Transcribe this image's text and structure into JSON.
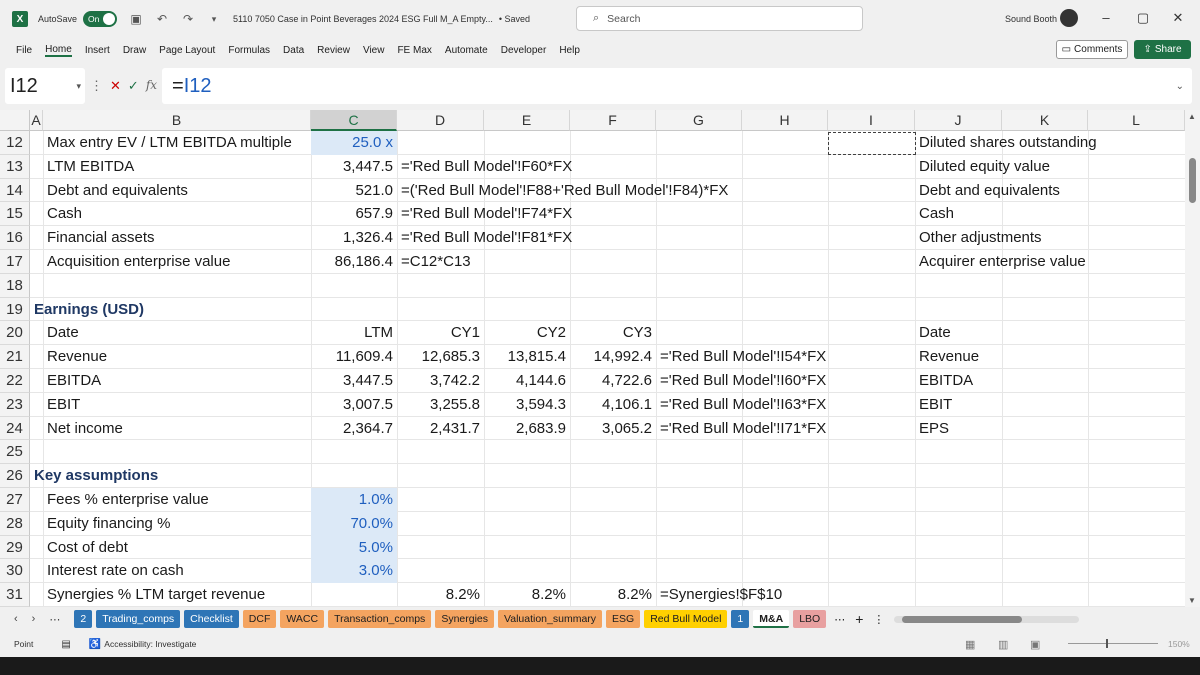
{
  "titlebar": {
    "autosave_label": "AutoSave",
    "autosave_state": "On",
    "file_name": "5110 7050 Case in Point Beverages 2024 ESG Full M_A Empty...",
    "saved_status": "• Saved",
    "search_placeholder": "Search",
    "user_name": "Sound Booth"
  },
  "ribbon": {
    "tabs": [
      "File",
      "Home",
      "Insert",
      "Draw",
      "Page Layout",
      "Formulas",
      "Data",
      "Review",
      "View",
      "FE Max",
      "Automate",
      "Developer",
      "Help"
    ],
    "active_tab": "Home",
    "comments_label": "Comments",
    "share_label": "Share"
  },
  "formula_bar": {
    "name_box": "I12",
    "formula_eq": "=",
    "formula_ref": "I12"
  },
  "columns": [
    "A",
    "B",
    "C",
    "D",
    "E",
    "F",
    "G",
    "H",
    "I",
    "J",
    "K",
    "L"
  ],
  "selected_column": "C",
  "rows": [
    {
      "num": "12",
      "B": "Max entry EV / LTM EBITDA multiple",
      "C": "25.0 x",
      "D": "",
      "E": "",
      "F": "",
      "G": "",
      "J": "Diluted shares outstanding"
    },
    {
      "num": "13",
      "B": "LTM EBITDA",
      "C": "3,447.5",
      "D": "='Red Bull Model'!F60*FX",
      "E": "",
      "F": "",
      "G": "",
      "J": "Diluted equity value"
    },
    {
      "num": "14",
      "B": "Debt and equivalents",
      "C": "521.0",
      "D": "=('Red Bull Model'!F88+'Red Bull Model'!F84)*FX",
      "E": "",
      "F": "",
      "G": "",
      "J": "Debt and equivalents"
    },
    {
      "num": "15",
      "B": "Cash",
      "C": "657.9",
      "D": "='Red Bull Model'!F74*FX",
      "E": "",
      "F": "",
      "G": "",
      "J": "Cash"
    },
    {
      "num": "16",
      "B": "Financial assets",
      "C": "1,326.4",
      "D": "='Red Bull Model'!F81*FX",
      "E": "",
      "F": "",
      "G": "",
      "J": "Other adjustments"
    },
    {
      "num": "17",
      "B": "Acquisition enterprise value",
      "C": "86,186.4",
      "D": "=C12*C13",
      "E": "",
      "F": "",
      "G": "",
      "J": "Acquirer enterprise value"
    },
    {
      "num": "18",
      "B": "",
      "C": "",
      "D": "",
      "E": "",
      "F": "",
      "G": "",
      "J": ""
    },
    {
      "num": "19",
      "A": "Earnings (USD)",
      "B": "",
      "C": "",
      "D": "",
      "E": "",
      "F": "",
      "G": "",
      "J": ""
    },
    {
      "num": "20",
      "B": "Date",
      "C": "LTM",
      "D": "CY1",
      "E": "CY2",
      "F": "CY3",
      "G": "",
      "J": "Date"
    },
    {
      "num": "21",
      "B": "Revenue",
      "C": "11,609.4",
      "D": "12,685.3",
      "E": "13,815.4",
      "F": "14,992.4",
      "G": "='Red Bull Model'!I54*FX",
      "J": "Revenue"
    },
    {
      "num": "22",
      "B": "EBITDA",
      "C": "3,447.5",
      "D": "3,742.2",
      "E": "4,144.6",
      "F": "4,722.6",
      "G": "='Red Bull Model'!I60*FX",
      "J": "EBITDA"
    },
    {
      "num": "23",
      "B": "EBIT",
      "C": "3,007.5",
      "D": "3,255.8",
      "E": "3,594.3",
      "F": "4,106.1",
      "G": "='Red Bull Model'!I63*FX",
      "J": "EBIT"
    },
    {
      "num": "24",
      "B": "Net income",
      "C": "2,364.7",
      "D": "2,431.7",
      "E": "2,683.9",
      "F": "3,065.2",
      "G": "='Red Bull Model'!I71*FX",
      "J": "EPS"
    },
    {
      "num": "25",
      "B": "",
      "C": "",
      "D": "",
      "E": "",
      "F": "",
      "G": "",
      "J": ""
    },
    {
      "num": "26",
      "A": "Key assumptions",
      "B": "",
      "C": "",
      "D": "",
      "E": "",
      "F": "",
      "G": "",
      "J": ""
    },
    {
      "num": "27",
      "B": "Fees % enterprise value",
      "C": "1.0%",
      "D": "",
      "E": "",
      "F": "",
      "G": "",
      "J": ""
    },
    {
      "num": "28",
      "B": "Equity financing %",
      "C": "70.0%",
      "D": "",
      "E": "",
      "F": "",
      "G": "",
      "J": ""
    },
    {
      "num": "29",
      "B": "Cost of debt",
      "C": "5.0%",
      "D": "",
      "E": "",
      "F": "",
      "G": "",
      "J": ""
    },
    {
      "num": "30",
      "B": "Interest rate on cash",
      "C": "3.0%",
      "D": "",
      "E": "",
      "F": "",
      "G": "",
      "J": ""
    },
    {
      "num": "31",
      "B": "Synergies % LTM target revenue",
      "C": "",
      "D": "8.2%",
      "E": "8.2%",
      "F": "8.2%",
      "G": "=Synergies!$F$10",
      "J": ""
    }
  ],
  "sheet_tabs": [
    {
      "label": "2",
      "color": "#2e75b6",
      "text": "#ffffff"
    },
    {
      "label": "Trading_comps",
      "color": "#2e75b6",
      "text": "#ffffff"
    },
    {
      "label": "Checklist",
      "color": "#2e75b6",
      "text": "#ffffff"
    },
    {
      "label": "DCF",
      "color": "#f4a460",
      "text": "#202020"
    },
    {
      "label": "WACC",
      "color": "#f4a460",
      "text": "#202020"
    },
    {
      "label": "Transaction_comps",
      "color": "#f4a460",
      "text": "#202020"
    },
    {
      "label": "Synergies",
      "color": "#f4a460",
      "text": "#202020"
    },
    {
      "label": "Valuation_summary",
      "color": "#f4a460",
      "text": "#202020"
    },
    {
      "label": "ESG",
      "color": "#f4a460",
      "text": "#202020"
    },
    {
      "label": "Red Bull Model",
      "color": "#ffd000",
      "text": "#202020"
    },
    {
      "label": "1",
      "color": "#2e75b6",
      "text": "#ffffff"
    },
    {
      "label": "M&A",
      "color": "#ffffff",
      "text": "#202020"
    },
    {
      "label": "LBO",
      "color": "#e8a0a0",
      "text": "#202020"
    }
  ],
  "status": {
    "mode": "Point",
    "accessibility": "Accessibility: Investigate",
    "zoom": "150%"
  },
  "colors": {
    "accent": "#1e7145",
    "input_fill": "#dce9f7",
    "input_text": "#1f5fbf",
    "section_title": "#1f3864"
  }
}
